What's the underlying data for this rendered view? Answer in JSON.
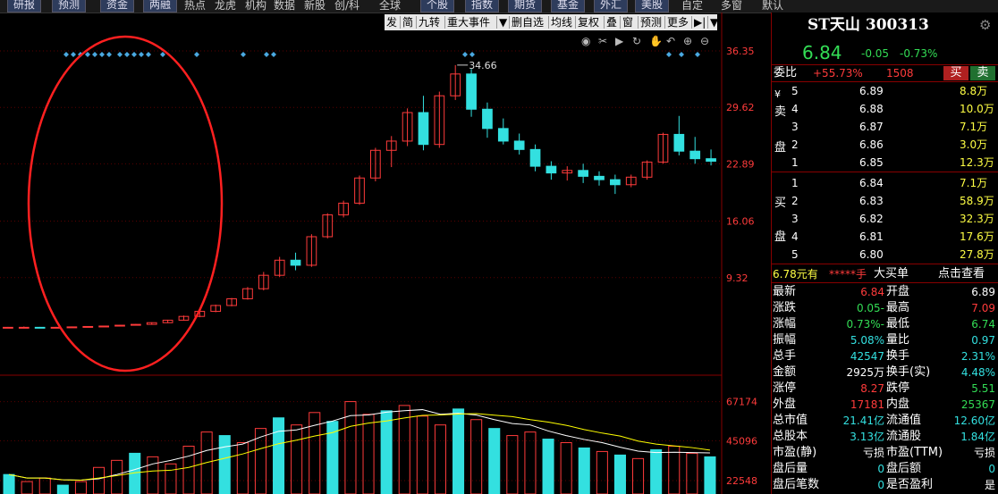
{
  "topbar": {
    "items": [
      "研报",
      "预测",
      "资金",
      "两融",
      "热点",
      "龙虎",
      "机构",
      "数据",
      "新股",
      "创/科",
      "全球",
      "个股",
      "指数",
      "期货",
      "基金",
      "外汇",
      "美股",
      "自定",
      "多窗",
      "默认"
    ]
  },
  "chart_toolbar": {
    "items": [
      "发",
      "简",
      "九转",
      "重大事件",
      "▼",
      "删自选",
      "均线",
      "复权",
      "叠",
      "窗",
      "预测",
      "更多",
      "▶|",
      "▼"
    ],
    "tools": [
      "eye-icon",
      "scissors-icon",
      "play-icon",
      "replay-icon",
      "hand-icon",
      "undo-icon",
      "zoom-in-icon",
      "zoom-out-icon"
    ]
  },
  "chart_data": [
    {
      "type": "candlestick",
      "title": "",
      "y_ticks": [
        36.35,
        29.62,
        22.89,
        16.06,
        9.32
      ],
      "ylim": [
        2.59,
        36.35
      ],
      "peak_label": "34.66",
      "candles_ohlc": [
        [
          3.4,
          3.45,
          3.35,
          3.4
        ],
        [
          3.4,
          3.5,
          3.3,
          3.4
        ],
        [
          3.4,
          3.45,
          3.3,
          3.35
        ],
        [
          3.35,
          3.45,
          3.3,
          3.4
        ],
        [
          3.4,
          3.5,
          3.35,
          3.45
        ],
        [
          3.45,
          3.55,
          3.4,
          3.5
        ],
        [
          3.5,
          3.6,
          3.45,
          3.55
        ],
        [
          3.55,
          3.7,
          3.5,
          3.65
        ],
        [
          3.65,
          3.8,
          3.6,
          3.75
        ],
        [
          3.75,
          4.0,
          3.7,
          3.95
        ],
        [
          3.95,
          4.3,
          3.9,
          4.25
        ],
        [
          4.25,
          4.8,
          4.2,
          4.7
        ],
        [
          4.7,
          5.4,
          4.6,
          5.3
        ],
        [
          5.3,
          6.1,
          5.2,
          6.0
        ],
        [
          6.0,
          6.9,
          5.9,
          6.8
        ],
        [
          6.8,
          8.2,
          6.7,
          8.0
        ],
        [
          8.0,
          10.0,
          7.8,
          9.6
        ],
        [
          9.6,
          11.8,
          9.4,
          11.4
        ],
        [
          11.4,
          12.3,
          10.2,
          10.8
        ],
        [
          10.8,
          14.5,
          10.6,
          14.2
        ],
        [
          14.2,
          17.0,
          14.0,
          16.8
        ],
        [
          16.8,
          18.5,
          16.5,
          18.2
        ],
        [
          18.2,
          21.5,
          18.0,
          21.2
        ],
        [
          21.2,
          24.8,
          20.8,
          24.5
        ],
        [
          24.5,
          26.2,
          22.5,
          25.6
        ],
        [
          25.6,
          29.5,
          25.0,
          29.0
        ],
        [
          29.0,
          31.0,
          24.5,
          25.2
        ],
        [
          25.2,
          31.5,
          24.8,
          31.0
        ],
        [
          31.0,
          34.66,
          30.5,
          33.6
        ],
        [
          33.6,
          34.2,
          28.5,
          29.4
        ],
        [
          29.4,
          30.2,
          26.0,
          27.1
        ],
        [
          27.1,
          28.3,
          25.2,
          25.6
        ],
        [
          25.6,
          26.5,
          24.0,
          24.6
        ],
        [
          24.6,
          25.2,
          22.0,
          22.6
        ],
        [
          22.6,
          23.2,
          21.0,
          21.8
        ],
        [
          21.8,
          22.6,
          20.9,
          22.1
        ],
        [
          22.1,
          22.9,
          20.6,
          21.4
        ],
        [
          21.4,
          22.0,
          20.3,
          21.0
        ],
        [
          21.0,
          21.6,
          19.3,
          20.4
        ],
        [
          20.4,
          21.6,
          20.1,
          21.3
        ],
        [
          21.3,
          23.3,
          21.0,
          23.1
        ],
        [
          23.1,
          26.6,
          22.9,
          26.4
        ],
        [
          26.4,
          28.6,
          23.9,
          24.4
        ],
        [
          24.4,
          26.1,
          22.9,
          23.5
        ],
        [
          23.5,
          24.6,
          22.7,
          23.2
        ]
      ]
    },
    {
      "type": "bar",
      "title": "",
      "y_ticks": [
        67174,
        45096,
        22548
      ],
      "ylim": [
        15000,
        72000
      ],
      "values": [
        26000,
        22000,
        24000,
        20000,
        22000,
        30000,
        34000,
        38000,
        36000,
        32000,
        42000,
        50000,
        48000,
        44000,
        52000,
        58000,
        54000,
        61000,
        56000,
        67174,
        60000,
        62000,
        65000,
        59000,
        54000,
        63000,
        57000,
        52000,
        48000,
        50000,
        46000,
        44000,
        41000,
        39000,
        37000,
        35000,
        40000,
        42000,
        38000,
        36000
      ],
      "up": [
        false,
        true,
        true,
        false,
        true,
        true,
        true,
        false,
        true,
        true,
        true,
        true,
        false,
        true,
        true,
        false,
        true,
        true,
        false,
        true,
        true,
        false,
        true,
        true,
        true,
        false,
        true,
        false,
        true,
        true,
        false,
        true,
        false,
        true,
        false,
        true,
        false,
        true,
        true,
        false
      ]
    }
  ],
  "quote": {
    "name": "ST天山",
    "code": "300313",
    "price": "6.84",
    "change": "-0.05",
    "change_pct": "-0.73%",
    "weibi_label": "委比",
    "weibi_value": "+55.73%",
    "weicha_value": "1508",
    "buy_label": "买",
    "sell_label": "卖",
    "sell_side_label": [
      "¥",
      "卖",
      "盘"
    ],
    "buy_side_label": [
      "买",
      "盘"
    ],
    "asks": [
      {
        "level": "5",
        "price": "6.89",
        "vol": "8.8万"
      },
      {
        "level": "4",
        "price": "6.88",
        "vol": "10.0万"
      },
      {
        "level": "3",
        "price": "6.87",
        "vol": "7.1万"
      },
      {
        "level": "2",
        "price": "6.86",
        "vol": "3.0万"
      },
      {
        "level": "1",
        "price": "6.85",
        "vol": "12.3万"
      }
    ],
    "bids": [
      {
        "level": "1",
        "price": "6.84",
        "vol": "7.1万"
      },
      {
        "level": "2",
        "price": "6.83",
        "vol": "58.9万"
      },
      {
        "level": "3",
        "price": "6.82",
        "vol": "32.3万"
      },
      {
        "level": "4",
        "price": "6.81",
        "vol": "17.6万"
      },
      {
        "level": "5",
        "price": "6.80",
        "vol": "27.8万"
      }
    ],
    "big_order": {
      "price": "6.78元有",
      "qty": "*****手",
      "label": "大买单",
      "link": "点击查看"
    },
    "stats": [
      {
        "l1": "最新",
        "v1": "6.84",
        "c1": "red",
        "l2": "开盘",
        "v2": "6.89",
        "c2": "white"
      },
      {
        "l1": "涨跌",
        "v1": "-0.05",
        "c1": "green",
        "l2": "最高",
        "v2": "7.09",
        "c2": "red"
      },
      {
        "l1": "涨幅",
        "v1": "-0.73%",
        "c1": "green",
        "l2": "最低",
        "v2": "6.74",
        "c2": "green"
      },
      {
        "l1": "振幅",
        "v1": "5.08%",
        "c1": "cyan",
        "l2": "量比",
        "v2": "0.97",
        "c2": "cyan"
      },
      {
        "l1": "总手",
        "v1": "42547",
        "c1": "cyan",
        "l2": "换手",
        "v2": "2.31%",
        "c2": "cyan"
      },
      {
        "l1": "金额",
        "v1": "2925万",
        "c1": "white",
        "l2": "换手(实)",
        "v2": "4.48%",
        "c2": "cyan"
      },
      {
        "l1": "涨停",
        "v1": "8.27",
        "c1": "red",
        "l2": "跌停",
        "v2": "5.51",
        "c2": "green"
      },
      {
        "l1": "外盘",
        "v1": "17181",
        "c1": "red",
        "l2": "内盘",
        "v2": "25367",
        "c2": "green"
      },
      {
        "l1": "总市值",
        "v1": "21.41亿",
        "c1": "cyan",
        "l2": "流通值",
        "v2": "12.60亿",
        "c2": "cyan"
      },
      {
        "l1": "总股本",
        "v1": "3.13亿",
        "c1": "cyan",
        "l2": "流通股",
        "v2": "1.84亿",
        "c2": "cyan"
      },
      {
        "l1": "市盈(静)",
        "v1": "亏损",
        "c1": "white",
        "l2": "市盈(TTM)",
        "v2": "亏损",
        "c2": "white"
      },
      {
        "l1": "盘后量",
        "v1": "0",
        "c1": "cyan",
        "l2": "盘后额",
        "v2": "0",
        "c2": "cyan"
      },
      {
        "l1": "盘后笔数",
        "v1": "0",
        "c1": "cyan",
        "l2": "是否盈利",
        "v2": "是",
        "c2": "white"
      }
    ]
  },
  "colors": {
    "up": "#ff3b3b",
    "down": "#33e0e0",
    "annotation": "#ff2020",
    "ma1": "#ffffff",
    "ma2": "#ffff00"
  }
}
